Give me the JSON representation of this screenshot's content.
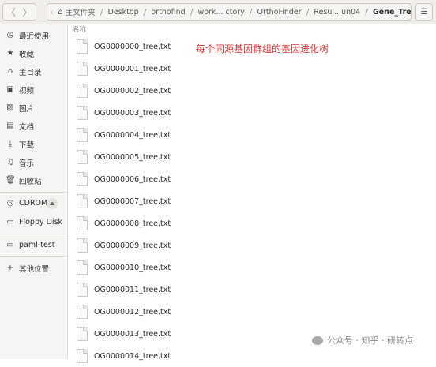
{
  "header": {
    "back_glyph": "〈",
    "forward_glyph": "〉",
    "menu_glyph": "☰",
    "home_glyph": "⌂",
    "path": [
      "主文件夹",
      "Desktop",
      "orthofind",
      "work... ctory",
      "OrthoFinder",
      "Resul...un04",
      "Gene_Trees"
    ]
  },
  "sidebar": {
    "items": [
      {
        "label": "最近使用",
        "glyph": "◷"
      },
      {
        "label": "收藏",
        "glyph": "★"
      },
      {
        "label": "主目录",
        "glyph": "⌂"
      },
      {
        "label": "视频",
        "glyph": "▣"
      },
      {
        "label": "图片",
        "glyph": "▨"
      },
      {
        "label": "文档",
        "glyph": "▤"
      },
      {
        "label": "下载",
        "glyph": "⤓"
      },
      {
        "label": "音乐",
        "glyph": "♫"
      },
      {
        "label": "回收站",
        "glyph": "🗑"
      },
      {
        "label": "CDROM",
        "glyph": "◎"
      },
      {
        "label": "Floppy Disk",
        "glyph": "▭"
      },
      {
        "label": "paml-test",
        "glyph": "▭"
      },
      {
        "label": "其他位置",
        "glyph": "+"
      }
    ],
    "eject_glyph": "⏏"
  },
  "main": {
    "column_name": "名称",
    "files": [
      "OG0000000_tree.txt",
      "OG0000001_tree.txt",
      "OG0000002_tree.txt",
      "OG0000003_tree.txt",
      "OG0000004_tree.txt",
      "OG0000005_tree.txt",
      "OG0000006_tree.txt",
      "OG0000007_tree.txt",
      "OG0000008_tree.txt",
      "OG0000009_tree.txt",
      "OG0000010_tree.txt",
      "OG0000011_tree.txt",
      "OG0000012_tree.txt",
      "OG0000013_tree.txt",
      "OG0000014_tree.txt"
    ]
  },
  "annotation": "每个同源基因群组的基因进化树",
  "watermark": "公众号 · 知乎 · 研转点",
  "colors": {
    "annotation": "#e23a3a",
    "sidebar_bg": "#f6f5f4",
    "header_bg": "#efeeed"
  }
}
